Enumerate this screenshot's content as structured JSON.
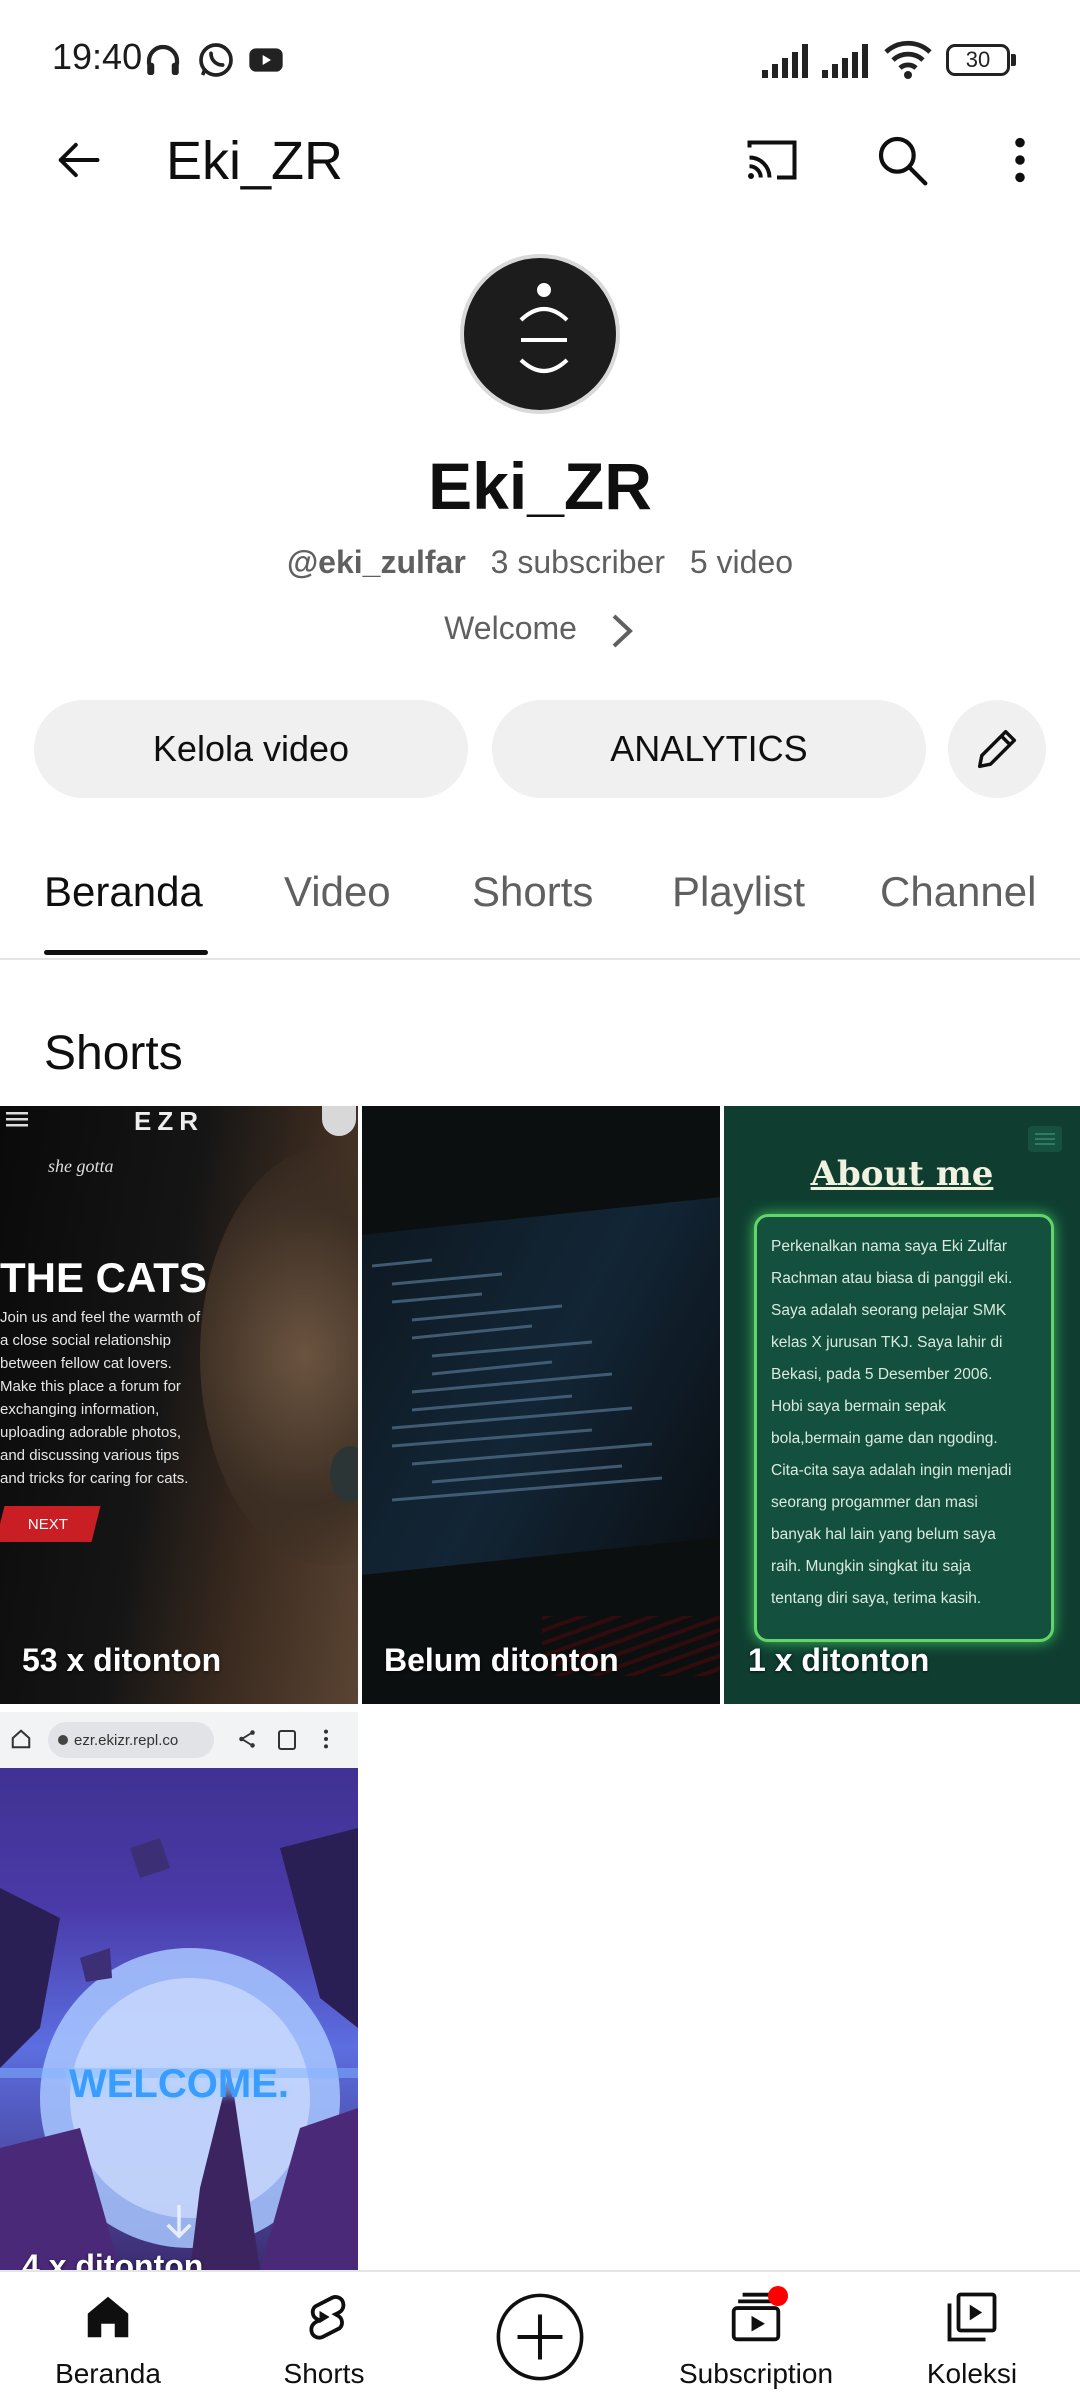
{
  "status_bar": {
    "time": "19:40",
    "battery": "30",
    "icons": [
      "headphones-icon",
      "whatsapp-icon",
      "youtube-icon",
      "signal-icon",
      "wifi-icon",
      "battery-icon"
    ]
  },
  "header": {
    "title": "Eki_ZR",
    "icons": [
      "back-arrow-icon",
      "cast-icon",
      "search-icon",
      "more-vert-icon"
    ]
  },
  "channel": {
    "name": "Eki_ZR",
    "handle": "@eki_zulfar",
    "subscribers": "3 subscriber",
    "videos": "5 video",
    "description": "Welcome"
  },
  "actions": {
    "manage_videos": "Kelola video",
    "analytics": "ANALYTICS"
  },
  "tabs": [
    {
      "label": "Beranda",
      "active": true
    },
    {
      "label": "Video",
      "active": false
    },
    {
      "label": "Shorts",
      "active": false
    },
    {
      "label": "Playlist",
      "active": false
    },
    {
      "label": "Channel",
      "active": false
    }
  ],
  "section": {
    "title": "Shorts"
  },
  "shorts": [
    {
      "views": "53 x ditonton",
      "thumb": {
        "brand": "EZR",
        "tagline": "she gotta",
        "headline": "THE CATS",
        "body_lines": [
          "Join us and feel the warmth of",
          "a close social relationship",
          "between fellow cat lovers.",
          "Make this place a forum for",
          "exchanging information,",
          "uploading adorable photos,",
          "and discussing various tips",
          "and tricks for caring for cats."
        ],
        "next_label": "NEXT"
      }
    },
    {
      "views": "Belum ditonton",
      "thumb": {}
    },
    {
      "views": "1 x ditonton",
      "thumb": {
        "heading": "About me",
        "body_lines": [
          "Perkenalkan nama saya Eki Zulfar",
          "Rachman atau biasa di panggil eki.",
          "Saya adalah seorang pelajar SMK",
          "kelas X jurusan TKJ. Saya lahir di",
          "Bekasi, pada 5 Desember 2006.",
          "Hobi saya bermain sepak",
          "bola,bermain game dan ngoding.",
          "Cita-cita saya adalah ingin menjadi",
          "seorang progammer dan masi",
          "banyak hal lain yang belum saya",
          "raih. Mungkin singkat itu saja",
          "tentang diri saya, terima kasih."
        ]
      }
    },
    {
      "views": "4 x ditonton",
      "thumb": {
        "url": "ezr.ekizr.repl.co",
        "headline": "WELCOME."
      }
    }
  ],
  "bottom_nav": [
    {
      "label": "Beranda",
      "icon": "home-icon"
    },
    {
      "label": "Shorts",
      "icon": "shorts-icon"
    },
    {
      "label": "",
      "icon": "create-icon"
    },
    {
      "label": "Subscription",
      "icon": "subscriptions-icon"
    },
    {
      "label": "Koleksi",
      "icon": "library-icon"
    }
  ],
  "colors": {
    "text_primary": "#0f0f0f",
    "text_secondary": "#606060",
    "pill_bg": "#f0f0f0",
    "notification_dot": "#ff0000",
    "about_green": "#0f3e31"
  }
}
